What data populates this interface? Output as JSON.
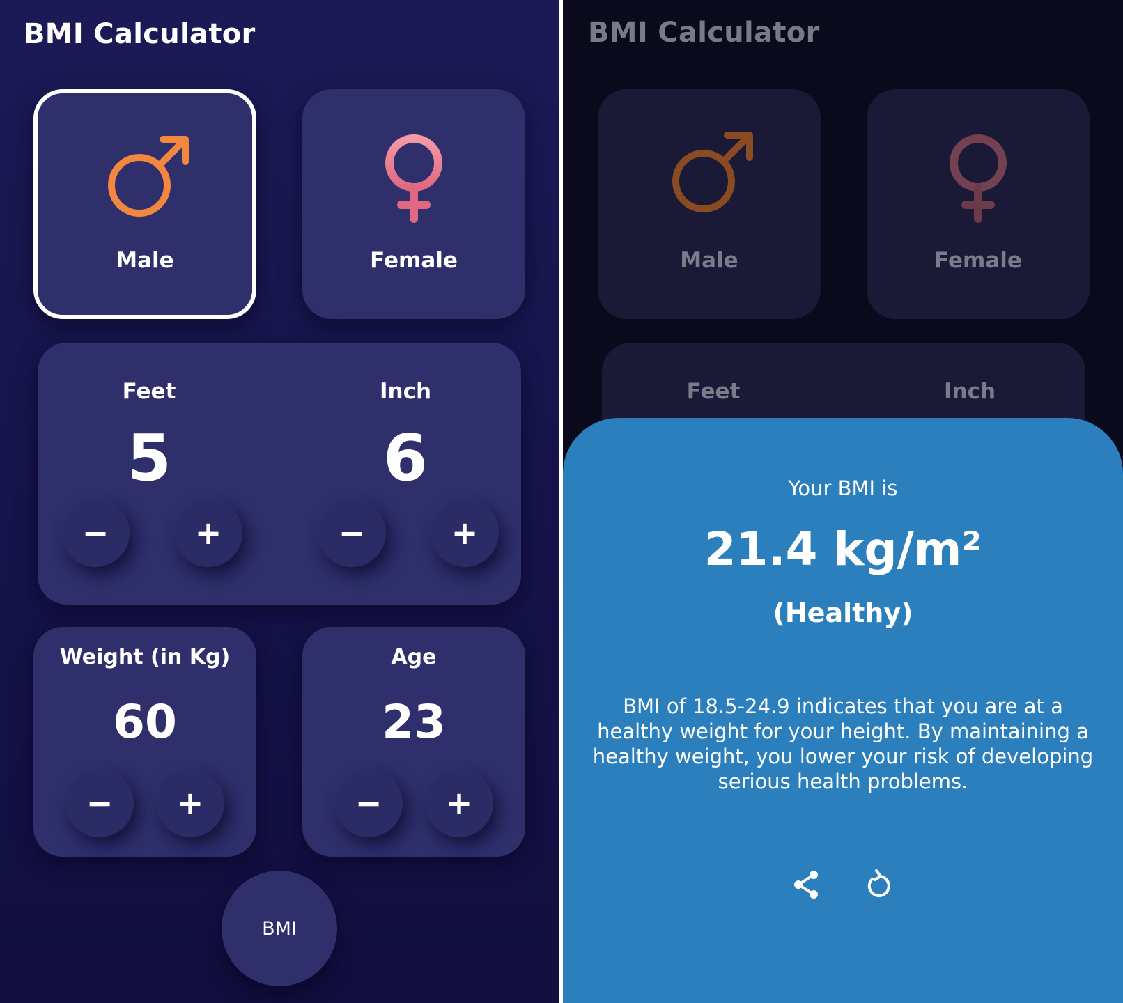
{
  "left": {
    "title": "BMI Calculator",
    "gender": {
      "male_label": "Male",
      "female_label": "Female",
      "selected": "male"
    },
    "height": {
      "feet_label": "Feet",
      "feet_value": "5",
      "inch_label": "Inch",
      "inch_value": "6"
    },
    "weight": {
      "label": "Weight (in Kg)",
      "value": "60"
    },
    "age": {
      "label": "Age",
      "value": "23"
    },
    "stepper": {
      "minus": "−",
      "plus": "+"
    },
    "bmi_button_label": "BMI"
  },
  "right": {
    "title": "BMI Calculator",
    "male_label": "Male",
    "female_label": "Female",
    "feet_label": "Feet",
    "inch_label": "Inch",
    "result": {
      "heading": "Your BMI is",
      "value": "21.4 kg/m²",
      "status": "(Healthy)",
      "description": "BMI of 18.5-24.9 indicates that you are at a healthy weight for your height. By maintaining a healthy weight, you lower your risk of developing serious health problems."
    },
    "actions": {
      "share_icon": "share-icon",
      "reset_icon": "reset-icon"
    }
  },
  "colors": {
    "background_left": "#1b1a56",
    "card": "#2e2f6b",
    "male_icon": "#f2873f",
    "female_icon": "#f28a98",
    "sheet": "#2c7fbd"
  }
}
